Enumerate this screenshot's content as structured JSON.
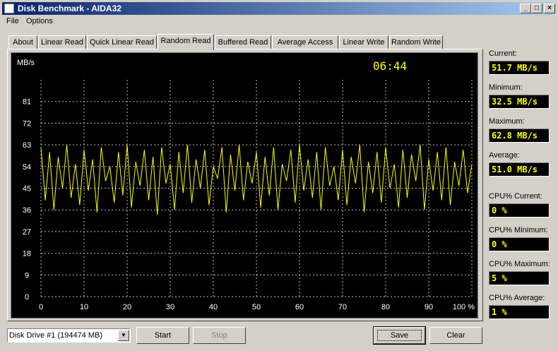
{
  "window": {
    "title": "Disk Benchmark - AIDA32",
    "controls": {
      "minimize": "_",
      "maximize": "□",
      "close": "×"
    }
  },
  "menu": [
    "File",
    "Options"
  ],
  "tabs": [
    "About",
    "Linear Read",
    "Quick Linear Read",
    "Random Read",
    "Buffered Read",
    "Average Access",
    "Linear Write",
    "Random Write"
  ],
  "active_tab": "Random Read",
  "timer": "06:44",
  "stats": [
    {
      "label": "Current:",
      "value": "51.7 MB/s"
    },
    {
      "label": "Minimum:",
      "value": "32.5 MB/s"
    },
    {
      "label": "Maximum:",
      "value": "62.8 MB/s"
    },
    {
      "label": "Average:",
      "value": "51.0 MB/s"
    },
    {
      "label": "CPU% Current:",
      "value": "0 %"
    },
    {
      "label": "CPU% Minimum:",
      "value": "0 %"
    },
    {
      "label": "CPU% Maximum:",
      "value": "5 %"
    },
    {
      "label": "CPU% Average:",
      "value": "1 %"
    }
  ],
  "drive_select": {
    "value": "Disk Drive #1  (194474 MB)"
  },
  "buttons": {
    "start": "Start",
    "stop": "Stop",
    "save": "Save",
    "clear": "Clear"
  },
  "chart_data": {
    "type": "line",
    "ylabel": "MB/s",
    "ylim": [
      0,
      90
    ],
    "yticks": [
      0,
      9,
      18,
      27,
      36,
      45,
      54,
      63,
      72,
      81
    ],
    "xlim": [
      0,
      100
    ],
    "xticks": [
      "0",
      "10",
      "20",
      "30",
      "40",
      "50",
      "60",
      "70",
      "80",
      "90",
      "100 %"
    ],
    "grid": true,
    "line_color": "#ffff00",
    "series": [
      {
        "x": [
          0,
          1,
          2,
          3,
          4,
          5,
          6,
          7,
          8,
          9,
          10,
          11,
          12,
          13,
          14,
          15,
          16,
          17,
          18,
          19,
          20,
          21,
          22,
          23,
          24,
          25,
          26,
          27,
          28,
          29,
          30,
          31,
          32,
          33,
          34,
          35,
          36,
          37,
          38,
          39,
          40,
          41,
          42,
          43,
          44,
          45,
          46,
          47,
          48,
          49,
          50,
          51,
          52,
          53,
          54,
          55,
          56,
          57,
          58,
          59,
          60,
          61,
          62,
          63,
          64,
          65,
          66,
          67,
          68,
          69,
          70,
          71,
          72,
          73,
          74,
          75,
          76,
          77,
          78,
          79,
          80,
          81,
          82,
          83,
          84,
          85,
          86,
          87,
          88,
          89,
          90,
          91,
          92,
          93,
          94,
          95,
          96,
          97,
          98,
          99,
          100
        ],
        "values": [
          62,
          40,
          60,
          36,
          58,
          45,
          63,
          41,
          55,
          38,
          61,
          44,
          57,
          35,
          62,
          48,
          54,
          39,
          60,
          42,
          63,
          37,
          56,
          46,
          61,
          40,
          58,
          34,
          62,
          47,
          55,
          36,
          60,
          43,
          63,
          39,
          57,
          45,
          61,
          38,
          54,
          49,
          62,
          35,
          59,
          44,
          63,
          40,
          56,
          47,
          60,
          37,
          58,
          42,
          62,
          36,
          55,
          48,
          61,
          39,
          63,
          44,
          57,
          41,
          60,
          36,
          62,
          46,
          54,
          40,
          61,
          38,
          58,
          47,
          63,
          35,
          56,
          43,
          60,
          39,
          62,
          45,
          55,
          37,
          61,
          41,
          59,
          48,
          63,
          36,
          57,
          44,
          60,
          40,
          62,
          38,
          56,
          46,
          61,
          43,
          55
        ]
      }
    ]
  }
}
